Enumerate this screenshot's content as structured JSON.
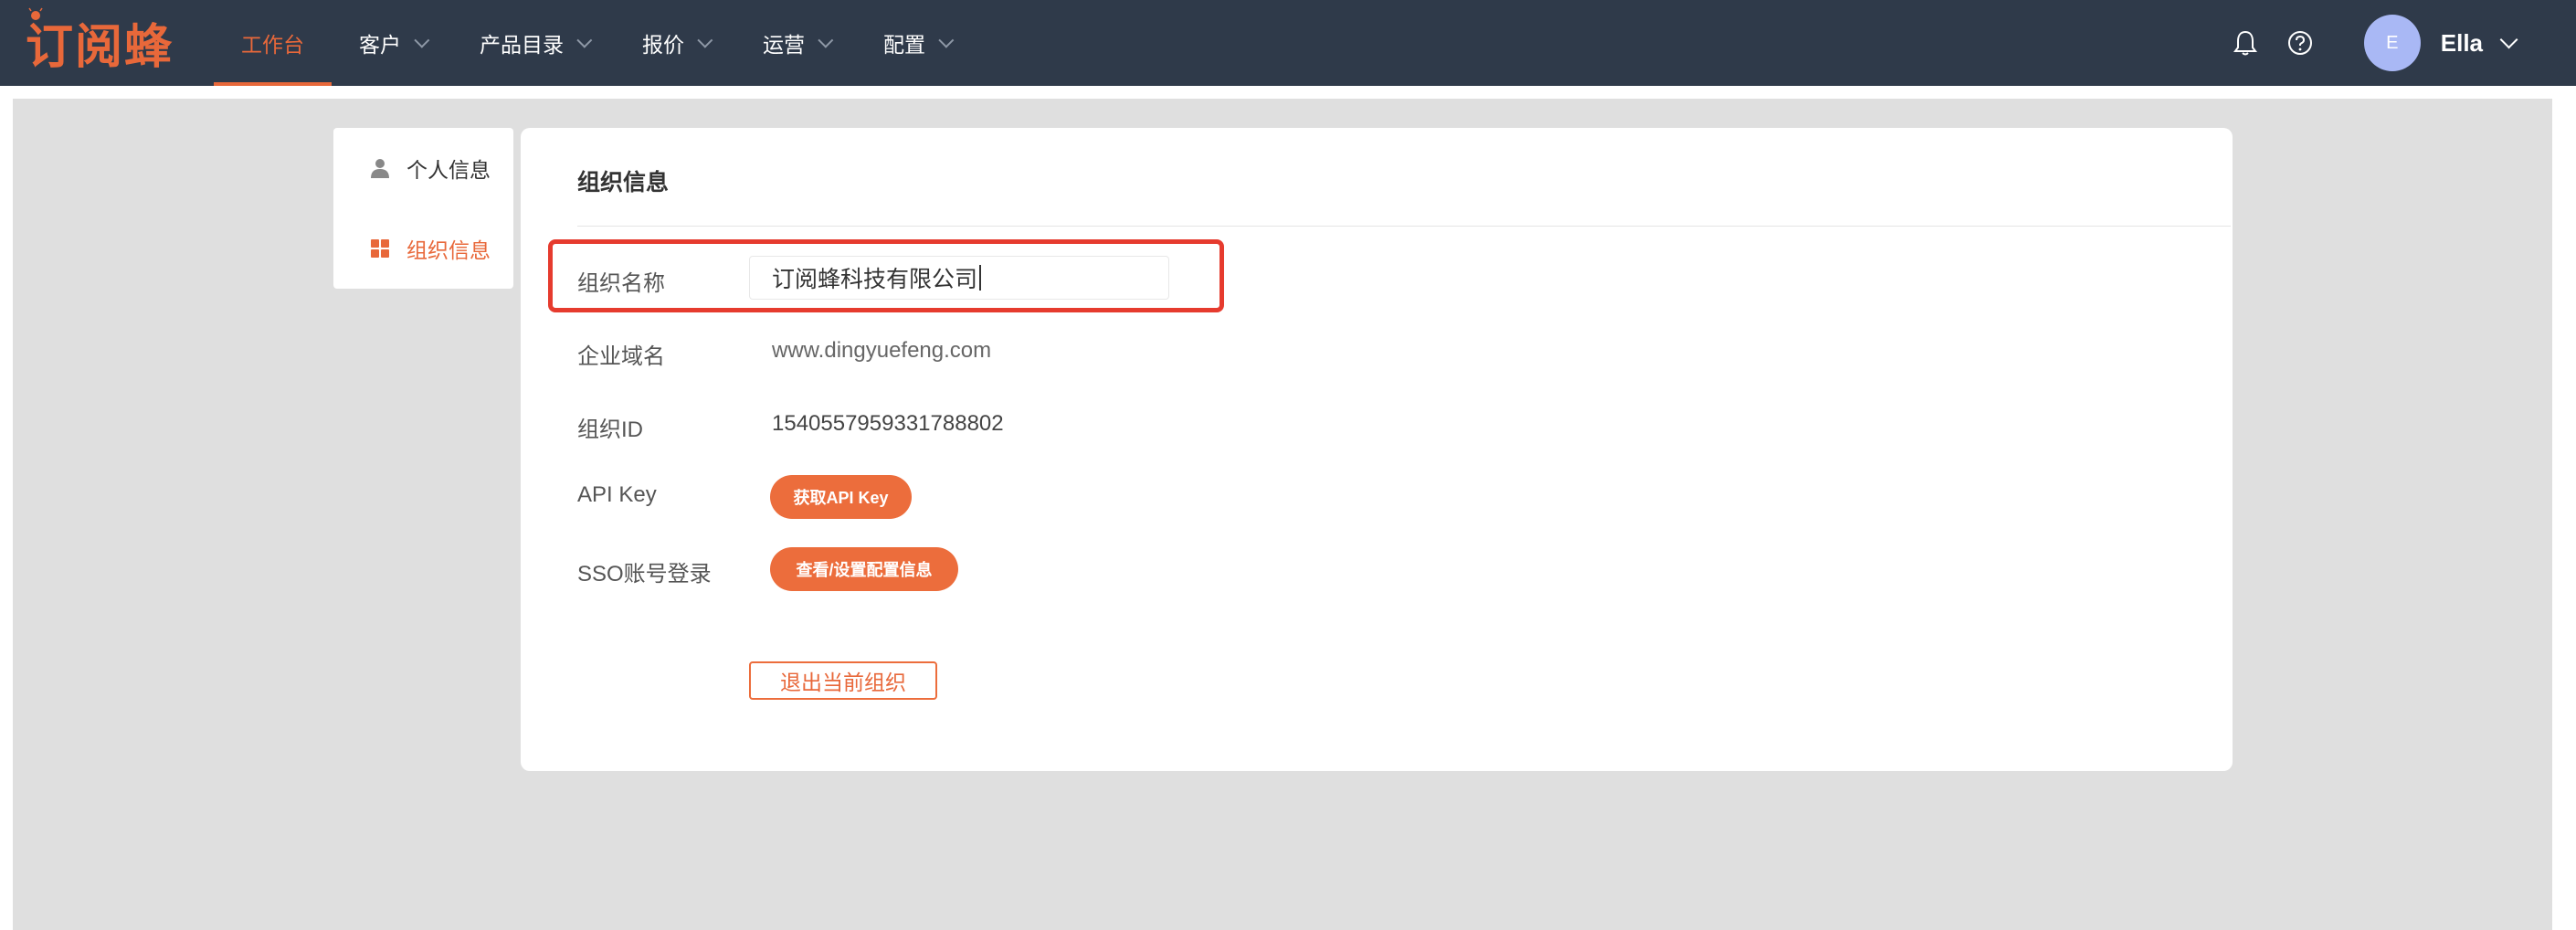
{
  "brand": {
    "name": "订阅蜂"
  },
  "nav": [
    {
      "label": "工作台",
      "active": true,
      "has_dropdown": false
    },
    {
      "label": "客户",
      "active": false,
      "has_dropdown": true
    },
    {
      "label": "产品目录",
      "active": false,
      "has_dropdown": true
    },
    {
      "label": "报价",
      "active": false,
      "has_dropdown": true
    },
    {
      "label": "运营",
      "active": false,
      "has_dropdown": true
    },
    {
      "label": "配置",
      "active": false,
      "has_dropdown": true
    }
  ],
  "header": {
    "notification_icon": "bell-icon",
    "help_icon": "question-circle-icon",
    "avatar_initial": "E",
    "user_name": "Ella"
  },
  "sidebar": {
    "items": [
      {
        "label": "个人信息",
        "icon": "user-icon",
        "active": false
      },
      {
        "label": "组织信息",
        "icon": "grid-icon",
        "active": true
      }
    ]
  },
  "org": {
    "title": "组织信息",
    "name_label": "组织名称",
    "name_value": "订阅蜂科技有限公司",
    "domain_label": "企业域名",
    "domain_value": "www.dingyuefeng.com",
    "id_label": "组织ID",
    "id_value": "1540557959331788802",
    "api_label": "API Key",
    "api_button": "获取API Key",
    "sso_label": "SSO账号登录",
    "sso_button": "查看/设置配置信息",
    "leave_button": "退出当前组织"
  },
  "colors": {
    "header_bg": "#2f3a4a",
    "accent": "#ec6d3c",
    "highlight": "#e63b2e",
    "page_bg": "#dfdfdf"
  }
}
